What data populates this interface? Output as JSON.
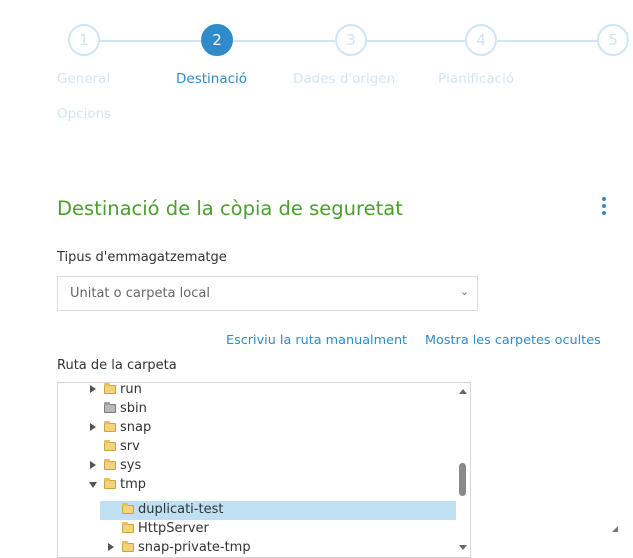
{
  "steps": [
    {
      "number": "1",
      "label": "General",
      "label2": "Opcions"
    },
    {
      "number": "2",
      "label": "Destinació"
    },
    {
      "number": "3",
      "label": "Dades d'origen"
    },
    {
      "number": "4",
      "label": "Planificació"
    },
    {
      "number": "5",
      "label": ""
    }
  ],
  "section": {
    "title": "Destinació de la còpia de seguretat",
    "menu_icon": "kebab-menu-icon"
  },
  "storage": {
    "label": "Tipus d'emmagatzematge",
    "selected": "Unitat o carpeta local"
  },
  "links": {
    "manual": "Escriviu la ruta manualment",
    "hidden": "Mostra les carpetes ocultes"
  },
  "folder": {
    "label": "Ruta de la carpeta",
    "tree": [
      {
        "name": "run"
      },
      {
        "name": "sbin"
      },
      {
        "name": "snap"
      },
      {
        "name": "srv"
      },
      {
        "name": "sys"
      },
      {
        "name": "tmp"
      },
      {
        "name": "duplicati-test"
      },
      {
        "name": "HttpServer"
      },
      {
        "name": "snap-private-tmp"
      }
    ]
  },
  "colors": {
    "accent": "#2f8bc9",
    "title_green": "#4b9e2f",
    "inactive_step": "#cfe6f2",
    "selection": "#bfe0f2"
  }
}
